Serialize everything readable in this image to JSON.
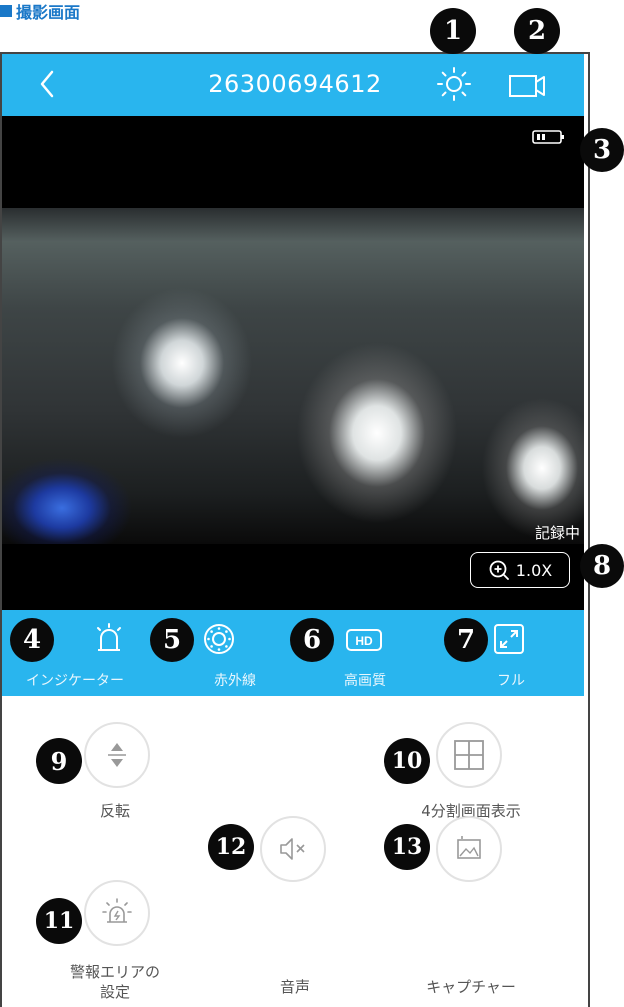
{
  "section": {
    "title": "撮影画面"
  },
  "header": {
    "title": "26300694612"
  },
  "video": {
    "status": "記録中",
    "zoom": "1.0X"
  },
  "toolbar": [
    {
      "label": "インジケーター"
    },
    {
      "label": "赤外線"
    },
    {
      "label": "高画質"
    },
    {
      "label": "フル"
    }
  ],
  "actions": {
    "flip": "反転",
    "split": "4分割画面表示",
    "alarm_area": "警報エリアの\n設定",
    "sound": "音声",
    "capture": "キャプチャー"
  },
  "badges": [
    "1",
    "2",
    "3",
    "4",
    "5",
    "6",
    "7",
    "8",
    "9",
    "10",
    "11",
    "12",
    "13"
  ],
  "icons": {
    "back": "chevron-left-icon",
    "brightness": "sun-icon",
    "record": "video-camera-icon",
    "battery": "battery-icon",
    "zoom": "zoom-in-icon",
    "indicator": "alarm-light-icon",
    "infrared": "infrared-icon",
    "hd": "hd-icon",
    "fullscreen": "fullscreen-icon",
    "flip": "flip-vertical-icon",
    "split": "grid-4-icon",
    "alarm_area": "alarm-zone-icon",
    "sound": "speaker-mute-icon",
    "capture": "image-capture-icon"
  },
  "colors": {
    "accent": "#29b5ee",
    "video_bg": "#000000",
    "badge": "#0a0a0a"
  }
}
